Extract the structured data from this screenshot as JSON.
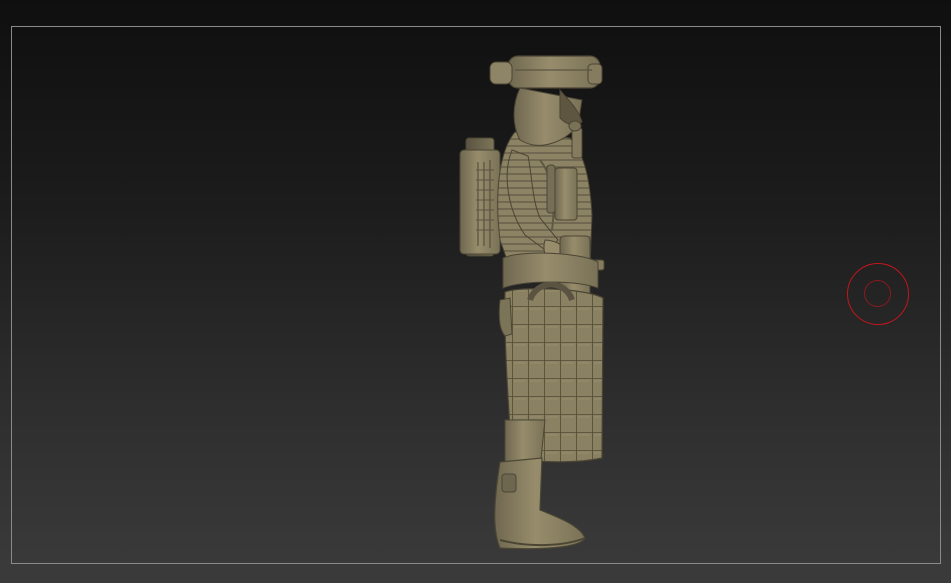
{
  "viewport": {
    "background_top": "#0f0f0f",
    "background_bottom": "#3b3b3b",
    "frame_color": "#8a8a8a"
  },
  "model": {
    "name": "soldier-sculpt",
    "material_color": "#8f8566",
    "shadow_color": "#5e5640",
    "highlight_color": "#b4aa87"
  },
  "brush": {
    "icon": "brush-cursor-icon",
    "outer_color": "#c4161c",
    "inner_color": "#8a1a1e"
  }
}
